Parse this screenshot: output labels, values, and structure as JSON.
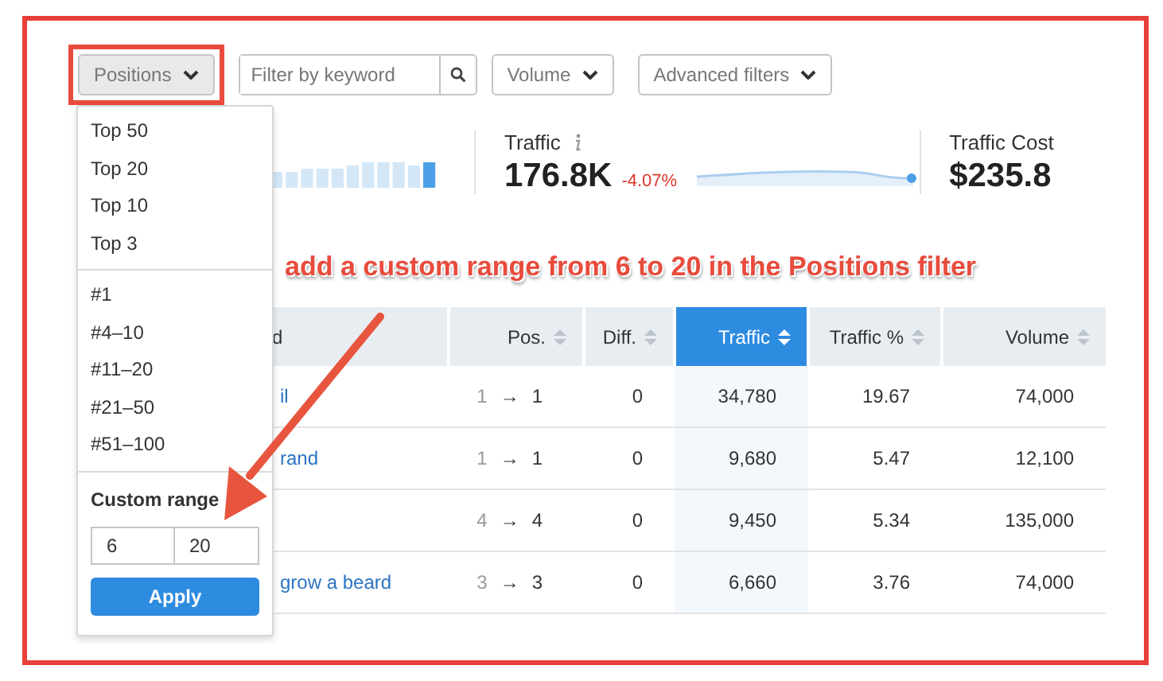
{
  "toolbar": {
    "positions_button": {
      "label": "Positions",
      "highlighted": true,
      "pressed": true
    },
    "keyword_filter": {
      "placeholder": "Filter by keyword"
    },
    "volume_button": {
      "label": "Volume"
    },
    "advanced_filters_button": {
      "label": "Advanced filters"
    }
  },
  "positions_menu": {
    "groups": [
      [
        "Top 50",
        "Top 20",
        "Top 10",
        "Top 3"
      ],
      [
        "#1",
        "#4–10",
        "#11–20",
        "#21–50",
        "#51–100"
      ]
    ],
    "custom_range": {
      "label": "Custom range",
      "from": "6",
      "to": "20"
    },
    "apply_button": "Apply"
  },
  "metrics": [
    {
      "kind": "bars"
    },
    {
      "kind": "value",
      "label": "Traffic",
      "info_icon": true,
      "value": "176.8K",
      "change": "-4.07%",
      "sparkline": true
    },
    {
      "kind": "value",
      "label": "Traffic Cost",
      "info_icon": false,
      "value": "$235.8",
      "sparkline": false
    }
  ],
  "annotation": {
    "text": "add a custom range from 6 to 20 in the Positions filter"
  },
  "table": {
    "columns": [
      {
        "label": "d",
        "sortable": false,
        "selected": false
      },
      {
        "label": "Pos.",
        "sortable": true,
        "selected": false
      },
      {
        "label": "Diff.",
        "sortable": true,
        "selected": false
      },
      {
        "label": "Traffic",
        "sortable": true,
        "selected": true
      },
      {
        "label": "Traffic %",
        "sortable": true,
        "selected": false
      },
      {
        "label": "Volume",
        "sortable": true,
        "selected": false
      }
    ],
    "rows": [
      {
        "keyword": "il",
        "pos_from": "1",
        "pos_arrow": "→",
        "pos_to": "1",
        "diff": "0",
        "traffic": "34,780",
        "traffic_pct": "19.67",
        "volume": "74,000"
      },
      {
        "keyword": "rand",
        "pos_from": "1",
        "pos_arrow": "→",
        "pos_to": "1",
        "diff": "0",
        "traffic": "9,680",
        "traffic_pct": "5.47",
        "volume": "12,100"
      },
      {
        "keyword": "",
        "pos_from": "4",
        "pos_arrow": "→",
        "pos_to": "4",
        "diff": "0",
        "traffic": "9,450",
        "traffic_pct": "5.34",
        "volume": "135,000"
      },
      {
        "keyword": "grow a beard",
        "pos_from": "3",
        "pos_arrow": "→",
        "pos_to": "3",
        "diff": "0",
        "traffic": "6,660",
        "traffic_pct": "3.76",
        "volume": "74,000"
      }
    ]
  }
}
